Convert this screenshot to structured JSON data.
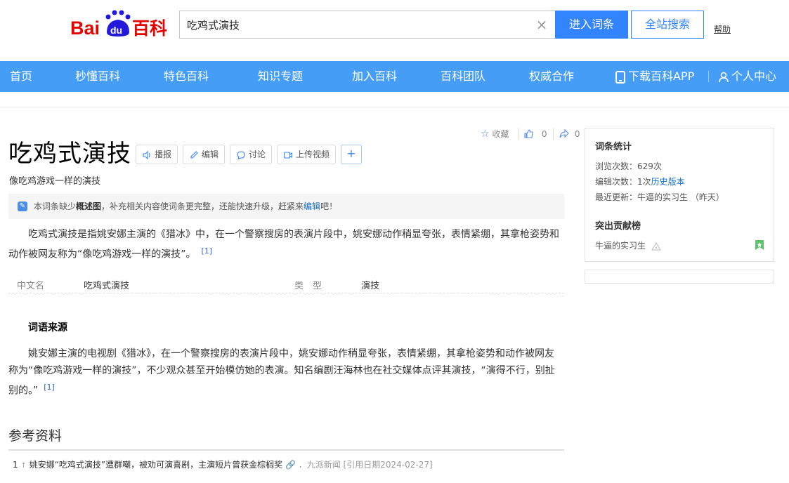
{
  "header": {
    "logo_text": "Baidu百科",
    "search_value": "吃鸡式演技",
    "enter_button": "进入词条",
    "all_search_button": "全站搜索",
    "help_link": "帮助"
  },
  "nav": {
    "items": [
      "首页",
      "秒懂百科",
      "特色百科",
      "知识专题",
      "加入百科",
      "百科团队",
      "权威合作"
    ],
    "download_app": "下载百科APP",
    "personal_center": "个人中心"
  },
  "entry": {
    "title": "吃鸡式演技",
    "subtitle": "像吃鸡游戏一样的演技",
    "toolbar": {
      "broadcast": "播报",
      "edit": "编辑",
      "discuss": "讨论",
      "upload_video": "上传视频",
      "add": "+"
    },
    "actions": {
      "collect": "收藏",
      "like_count": "0",
      "share_count": "0"
    },
    "notice": {
      "prefix": "本词条缺少",
      "bold": "概述图",
      "middle": "，补充相关内容使词条更完整，还能快速升级，赶紧来",
      "link": "编辑",
      "suffix": "吧！"
    },
    "summary": "吃鸡式演技是指姚安娜主演的《猎冰》中，在一个警察搜房的表演片段中，姚安娜动作稍显夸张，表情紧绷，其拿枪姿势和动作被网友称为“像吃鸡游戏一样的演技”。",
    "summary_ref": "[1]",
    "info": {
      "key1": "中文名",
      "val1": "吃鸡式演技",
      "key2": "类　型",
      "val2": "演技"
    },
    "section_title": "词语来源",
    "section_body": "姚安娜主演的电视剧《猎冰》，在一个警察搜房的表演片段中，姚安娜动作稍显夸张，表情紧绷，其拿枪姿势和动作被网友称为“像吃鸡游戏一样的演技”，不少观众甚至开始模仿她的表演。知名编剧汪海林也在社交媒体点评其演技，“演得不行，别扯别的。”",
    "section_ref": "[1]",
    "references_title": "参考资料",
    "reference": {
      "num": "1",
      "arrow": "↑",
      "text": "姚安娜“吃鸡式演技”遭群嘲，被劝可演喜剧，主演短片曾获金棕榈奖",
      "source": "．九派新闻 [引用日期2024-02-27]"
    }
  },
  "sidebar": {
    "stats_title": "词条统计",
    "views": "浏览次数：629次",
    "edits_prefix": "编辑次数：1次",
    "history_link": "历史版本",
    "last_update": "最近更新：牛逼的实习生 （昨天）",
    "contrib_title": "突出贡献榜",
    "contributor": "牛逼的实习生"
  },
  "colors": {
    "accent": "#3385ff",
    "nav_bg": "#459df5",
    "link": "#136ec2",
    "logo_red": "#e10602",
    "logo_blue": "#2319dc"
  }
}
